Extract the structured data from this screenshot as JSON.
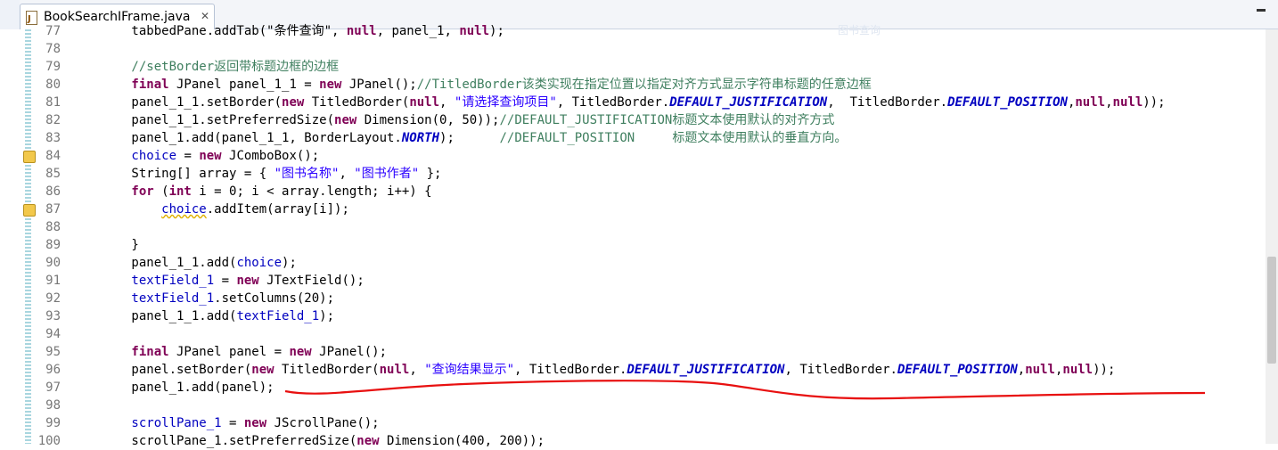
{
  "tab": {
    "title": "BookSearchIFrame.java",
    "close": "✕"
  },
  "watermark": "图书查询",
  "lines": [
    {
      "n": "77",
      "html": [
        [
          "",
          "        tabbedPane.addTab(\"条件查询\", "
        ],
        [
          "kw",
          "null"
        ],
        [
          "",
          ", panel_1, "
        ],
        [
          "kw",
          "null"
        ],
        [
          "",
          ");"
        ]
      ]
    },
    {
      "n": "78",
      "html": [
        [
          "",
          ""
        ]
      ]
    },
    {
      "n": "79",
      "html": [
        [
          "cm",
          "        //setBorder返回带标题边框的边框"
        ]
      ]
    },
    {
      "n": "80",
      "html": [
        [
          "kw",
          "        final"
        ],
        [
          "",
          " JPanel panel_1_1 = "
        ],
        [
          "kw",
          "new"
        ],
        [
          "",
          " JPanel();"
        ],
        [
          "cm",
          "//TitledBorder该类实现在指定位置以指定对齐方式显示字符串标题的任意边框"
        ]
      ]
    },
    {
      "n": "81",
      "html": [
        [
          "",
          "        panel_1_1.setBorder("
        ],
        [
          "kw",
          "new"
        ],
        [
          "",
          " TitledBorder("
        ],
        [
          "kw",
          "null"
        ],
        [
          "",
          ", "
        ],
        [
          "str",
          "\"请选择查询项目\""
        ],
        [
          "",
          ", TitledBorder."
        ],
        [
          "sfld",
          "DEFAULT_JUSTIFICATION"
        ],
        [
          "",
          ",  TitledBorder."
        ],
        [
          "sfld",
          "DEFAULT_POSITION"
        ],
        [
          "",
          ","
        ],
        [
          "kw",
          "null"
        ],
        [
          "",
          ","
        ],
        [
          "kw",
          "null"
        ],
        [
          "",
          "));"
        ]
      ]
    },
    {
      "n": "82",
      "html": [
        [
          "",
          "        panel_1_1.setPreferredSize("
        ],
        [
          "kw",
          "new"
        ],
        [
          "",
          " Dimension(0, 50));"
        ],
        [
          "cm",
          "//DEFAULT_JUSTIFICATION标题文本使用默认的对齐方式"
        ]
      ]
    },
    {
      "n": "83",
      "html": [
        [
          "",
          "        panel_1.add(panel_1_1, BorderLayout."
        ],
        [
          "sfld",
          "NORTH"
        ],
        [
          "",
          ");      "
        ],
        [
          "cm",
          "//DEFAULT_POSITION     标题文本使用默认的垂直方向。"
        ]
      ]
    },
    {
      "n": "84",
      "html": [
        [
          "fld",
          "        choice"
        ],
        [
          "",
          " = "
        ],
        [
          "kw",
          "new"
        ],
        [
          "",
          " JComboBox();"
        ]
      ]
    },
    {
      "n": "85",
      "html": [
        [
          "",
          "        String[] array = { "
        ],
        [
          "str",
          "\"图书名称\""
        ],
        [
          "",
          ", "
        ],
        [
          "str",
          "\"图书作者\""
        ],
        [
          "",
          " };"
        ]
      ]
    },
    {
      "n": "86",
      "html": [
        [
          "kw",
          "        for"
        ],
        [
          "",
          " ("
        ],
        [
          "kw",
          "int"
        ],
        [
          "",
          " i = 0; i < array.length; i++) {"
        ]
      ]
    },
    {
      "n": "87",
      "html": [
        [
          "",
          "            "
        ],
        [
          "fld warn",
          "choice"
        ],
        [
          "",
          ".addItem(array[i]);"
        ]
      ]
    },
    {
      "n": "88",
      "html": [
        [
          "",
          ""
        ]
      ]
    },
    {
      "n": "89",
      "html": [
        [
          "",
          "        }"
        ]
      ]
    },
    {
      "n": "90",
      "html": [
        [
          "",
          "        panel_1_1.add("
        ],
        [
          "fld",
          "choice"
        ],
        [
          "",
          ");"
        ]
      ]
    },
    {
      "n": "91",
      "html": [
        [
          "fld",
          "        textField_1"
        ],
        [
          "",
          " = "
        ],
        [
          "kw",
          "new"
        ],
        [
          "",
          " JTextField();"
        ]
      ]
    },
    {
      "n": "92",
      "html": [
        [
          "fld",
          "        textField_1"
        ],
        [
          "",
          ".setColumns(20);"
        ]
      ]
    },
    {
      "n": "93",
      "html": [
        [
          "",
          "        panel_1_1.add("
        ],
        [
          "fld",
          "textField_1"
        ],
        [
          "",
          ");"
        ]
      ]
    },
    {
      "n": "94",
      "html": [
        [
          "",
          ""
        ]
      ]
    },
    {
      "n": "95",
      "html": [
        [
          "kw",
          "        final"
        ],
        [
          "",
          " JPanel panel = "
        ],
        [
          "kw",
          "new"
        ],
        [
          "",
          " JPanel();"
        ]
      ]
    },
    {
      "n": "96",
      "html": [
        [
          "",
          "        panel.setBorder("
        ],
        [
          "kw",
          "new"
        ],
        [
          "",
          " TitledBorder("
        ],
        [
          "kw",
          "null"
        ],
        [
          "",
          ", "
        ],
        [
          "str",
          "\"查询结果显示\""
        ],
        [
          "",
          ", TitledBorder."
        ],
        [
          "sfld",
          "DEFAULT_JUSTIFICATION"
        ],
        [
          "",
          ", TitledBorder."
        ],
        [
          "sfld",
          "DEFAULT_POSITION"
        ],
        [
          "",
          ","
        ],
        [
          "kw",
          "null"
        ],
        [
          "",
          ","
        ],
        [
          "kw",
          "null"
        ],
        [
          "",
          "));"
        ]
      ]
    },
    {
      "n": "97",
      "html": [
        [
          "",
          "        panel_1.add(panel);"
        ]
      ]
    },
    {
      "n": "98",
      "html": [
        [
          "",
          ""
        ]
      ]
    },
    {
      "n": "99",
      "html": [
        [
          "fld",
          "        scrollPane_1"
        ],
        [
          "",
          " = "
        ],
        [
          "kw",
          "new"
        ],
        [
          "",
          " JScrollPane();"
        ]
      ]
    },
    {
      "n": "100",
      "html": [
        [
          "",
          "        scrollPane_1.setPreferredSize("
        ],
        [
          "kw",
          "new"
        ],
        [
          "",
          " Dimension(400, 200));"
        ]
      ]
    }
  ],
  "warning_lines": [
    "84",
    "87"
  ],
  "colors": {
    "annotation": "#e81010"
  }
}
